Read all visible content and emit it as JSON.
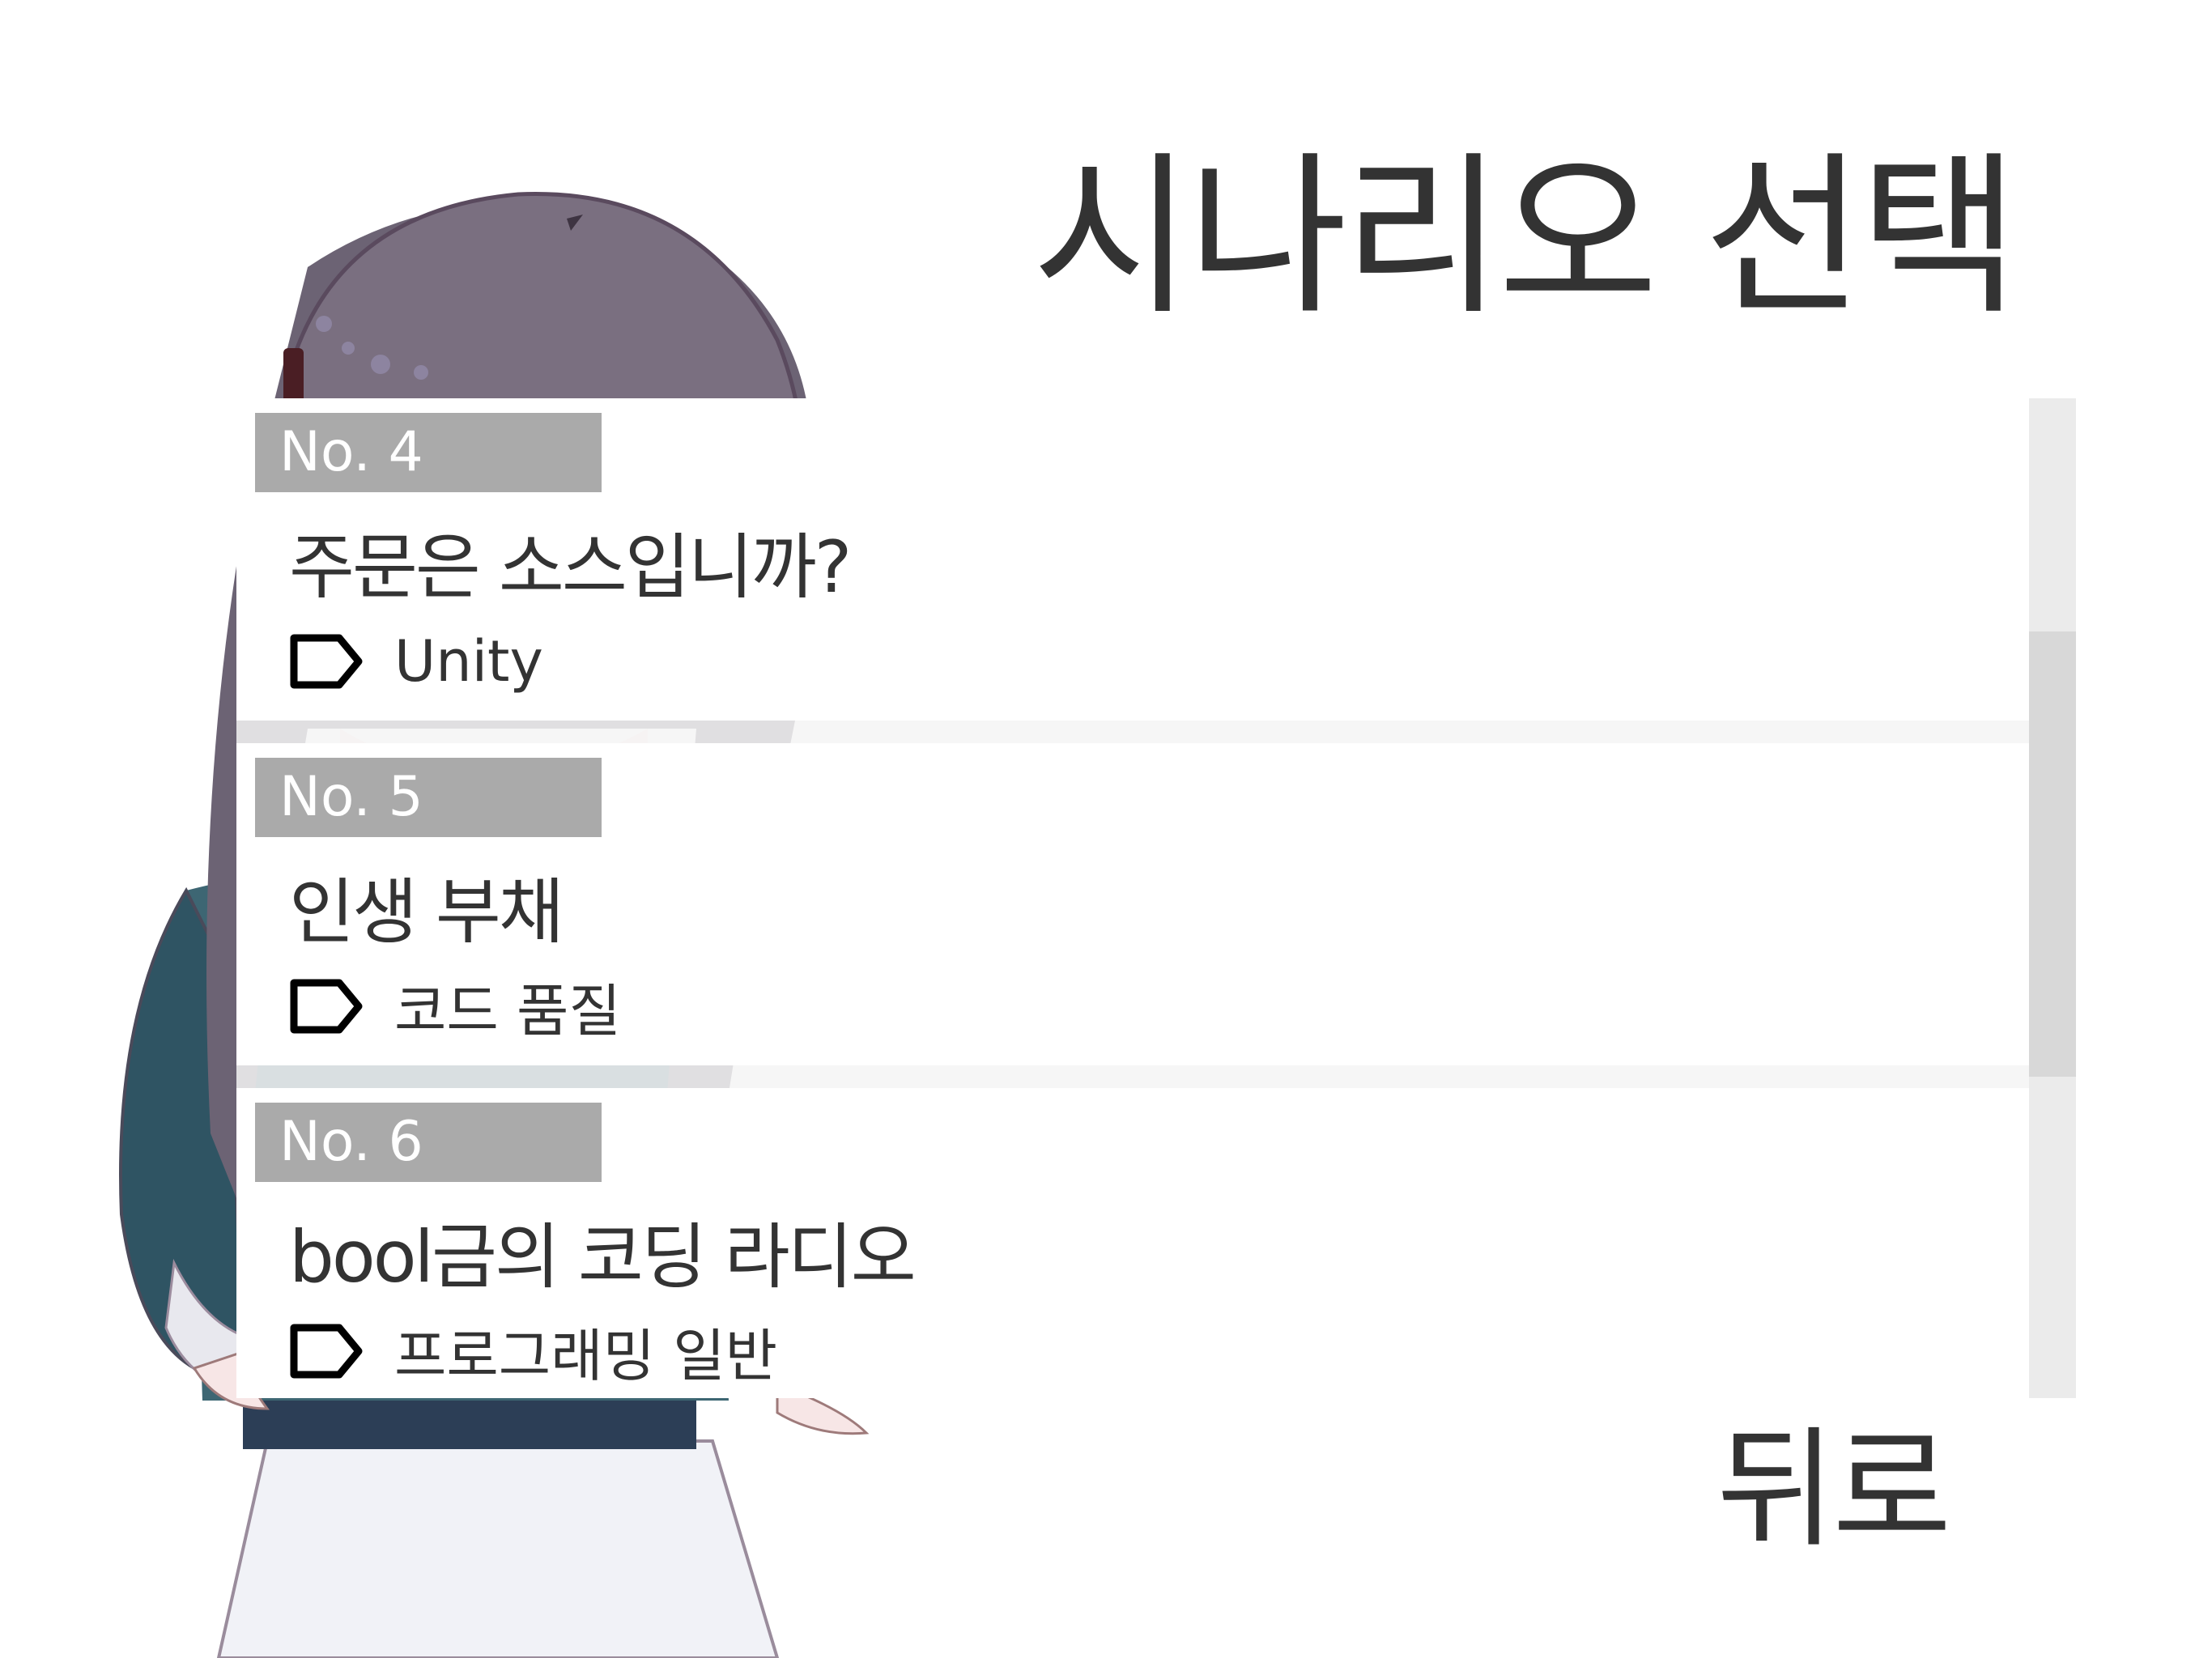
{
  "screen": {
    "title": "시나리오 선택",
    "back_label": "뒤로"
  },
  "scenarios": [
    {
      "number": "No. 4",
      "title": "주문은 소스입니까?",
      "tag": "Unity"
    },
    {
      "number": "No. 5",
      "title": "인생 부채",
      "tag": "코드 품질"
    },
    {
      "number": "No. 6",
      "title": "bool금의 코딩 라디오",
      "tag": "프로그래밍 일반"
    }
  ],
  "icons": {
    "tag": "tag-icon",
    "scroll": "scrollbar"
  },
  "colors": {
    "badge_bg": "#aaaaaa",
    "text": "#333333",
    "card_bg": "#ffffff",
    "scroll_track": "#ebebeb",
    "scroll_thumb": "#d8d8d8"
  },
  "scroll_position": 0.42
}
